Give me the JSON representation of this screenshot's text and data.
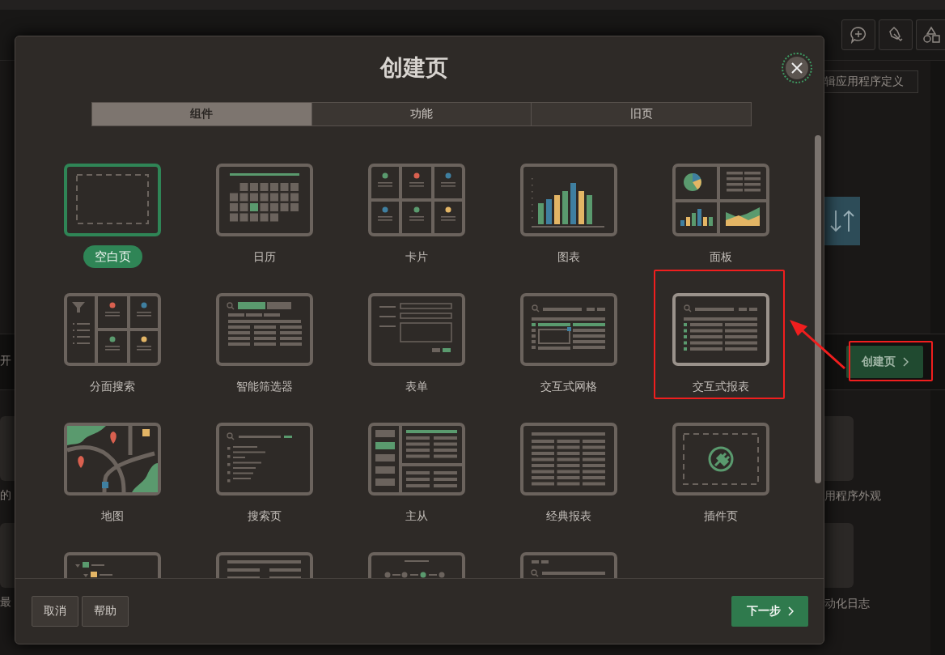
{
  "background_page": {
    "top_button": "辑应用程序定义",
    "create_page_button": "创建页",
    "left_texts": [
      "开",
      "的",
      "最"
    ],
    "right_texts": [
      "用程序外观",
      "动化日志"
    ]
  },
  "dialog": {
    "title": "创建页",
    "tabs": [
      {
        "label": "组件",
        "selected": true
      },
      {
        "label": "功能",
        "selected": false
      },
      {
        "label": "旧页",
        "selected": false
      }
    ],
    "tiles": [
      {
        "kind": "blank",
        "label": "空白页",
        "selected": true,
        "highlighted": false
      },
      {
        "kind": "calendar",
        "label": "日历",
        "selected": false,
        "highlighted": false
      },
      {
        "kind": "cards",
        "label": "卡片",
        "selected": false,
        "highlighted": false
      },
      {
        "kind": "chart",
        "label": "图表",
        "selected": false,
        "highlighted": false
      },
      {
        "kind": "dashboard",
        "label": "面板",
        "selected": false,
        "highlighted": false
      },
      {
        "kind": "faceted",
        "label": "分面搜索",
        "selected": false,
        "highlighted": false
      },
      {
        "kind": "smartfilter",
        "label": "智能筛选器",
        "selected": false,
        "highlighted": false
      },
      {
        "kind": "form",
        "label": "表单",
        "selected": false,
        "highlighted": false
      },
      {
        "kind": "grid",
        "label": "交互式网格",
        "selected": false,
        "highlighted": false
      },
      {
        "kind": "report",
        "label": "交互式报表",
        "selected": false,
        "highlighted": true
      },
      {
        "kind": "map",
        "label": "地图",
        "selected": false,
        "highlighted": false
      },
      {
        "kind": "search",
        "label": "搜索页",
        "selected": false,
        "highlighted": false
      },
      {
        "kind": "masterdetail",
        "label": "主从",
        "selected": false,
        "highlighted": false
      },
      {
        "kind": "classic",
        "label": "经典报表",
        "selected": false,
        "highlighted": false
      },
      {
        "kind": "plugin",
        "label": "插件页",
        "selected": false,
        "highlighted": false
      },
      {
        "kind": "tree",
        "selected": false,
        "highlighted": false
      },
      {
        "kind": "globe",
        "selected": false,
        "highlighted": false
      },
      {
        "kind": "steps",
        "selected": false,
        "highlighted": false
      },
      {
        "kind": "searchform",
        "selected": false,
        "highlighted": false
      }
    ],
    "footer": {
      "cancel": "取消",
      "help": "帮助",
      "next": "下一步"
    }
  }
}
